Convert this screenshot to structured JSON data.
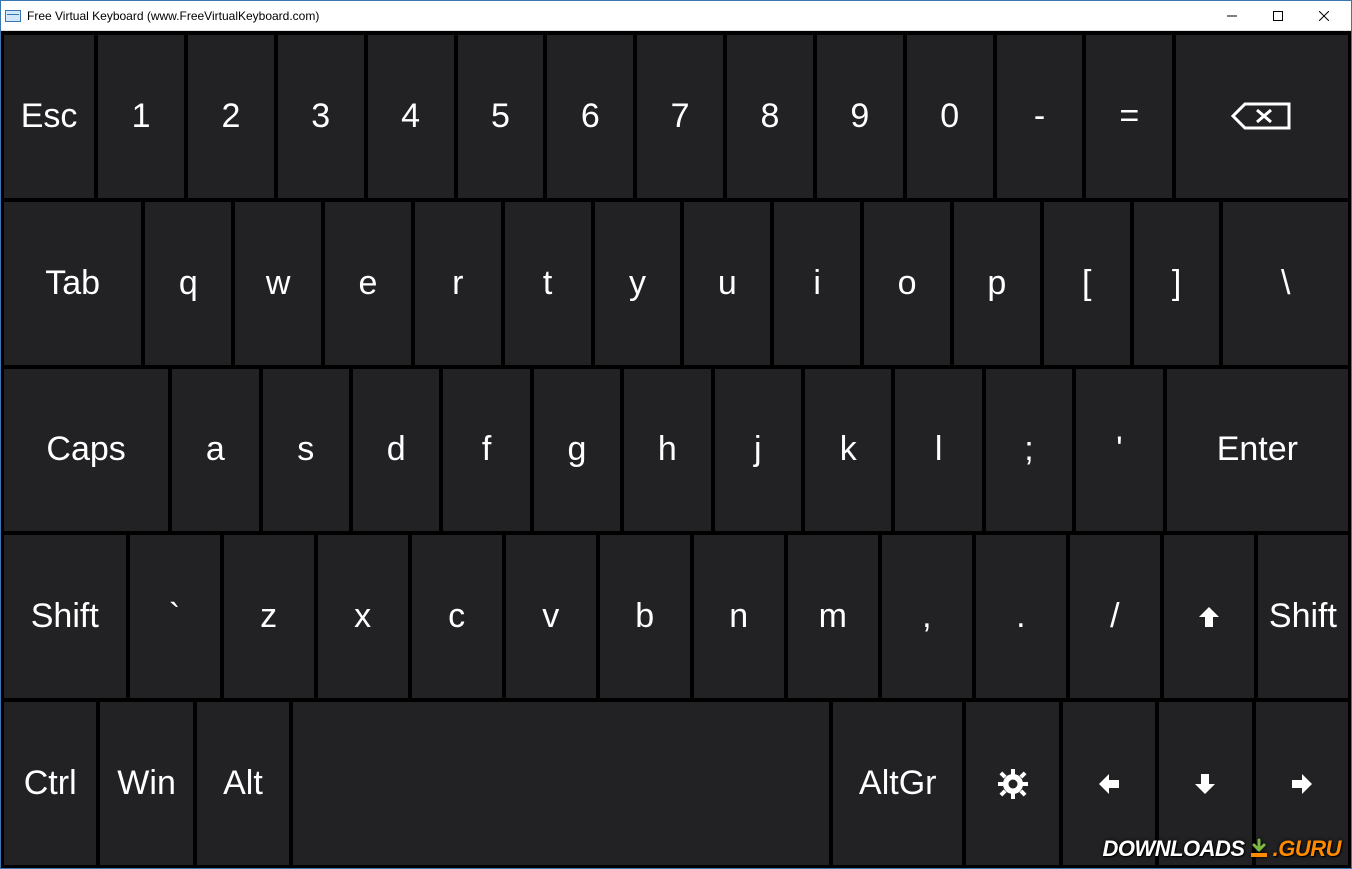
{
  "window": {
    "title": "Free Virtual Keyboard (www.FreeVirtualKeyboard.com)"
  },
  "colors": {
    "key_bg": "#222225",
    "client_bg": "#000000",
    "text": "#ffffff"
  },
  "rows": [
    {
      "keys": [
        {
          "id": "esc",
          "label": "Esc",
          "flex": 1.05
        },
        {
          "id": "1",
          "label": "1",
          "flex": 1
        },
        {
          "id": "2",
          "label": "2",
          "flex": 1
        },
        {
          "id": "3",
          "label": "3",
          "flex": 1
        },
        {
          "id": "4",
          "label": "4",
          "flex": 1
        },
        {
          "id": "5",
          "label": "5",
          "flex": 1
        },
        {
          "id": "6",
          "label": "6",
          "flex": 1
        },
        {
          "id": "7",
          "label": "7",
          "flex": 1
        },
        {
          "id": "8",
          "label": "8",
          "flex": 1
        },
        {
          "id": "9",
          "label": "9",
          "flex": 1
        },
        {
          "id": "0",
          "label": "0",
          "flex": 1
        },
        {
          "id": "minus",
          "label": "-",
          "flex": 1
        },
        {
          "id": "equal",
          "label": "=",
          "flex": 1
        },
        {
          "id": "backspace",
          "icon": "backspace",
          "flex": 2.0
        }
      ]
    },
    {
      "keys": [
        {
          "id": "tab",
          "label": "Tab",
          "flex": 1.6
        },
        {
          "id": "q",
          "label": "q",
          "flex": 1
        },
        {
          "id": "w",
          "label": "w",
          "flex": 1
        },
        {
          "id": "e",
          "label": "e",
          "flex": 1
        },
        {
          "id": "r",
          "label": "r",
          "flex": 1
        },
        {
          "id": "t",
          "label": "t",
          "flex": 1
        },
        {
          "id": "y",
          "label": "y",
          "flex": 1
        },
        {
          "id": "u",
          "label": "u",
          "flex": 1
        },
        {
          "id": "i",
          "label": "i",
          "flex": 1
        },
        {
          "id": "o",
          "label": "o",
          "flex": 1
        },
        {
          "id": "p",
          "label": "p",
          "flex": 1
        },
        {
          "id": "lbracket",
          "label": "[",
          "flex": 1
        },
        {
          "id": "rbracket",
          "label": "]",
          "flex": 1
        },
        {
          "id": "backslash",
          "label": "\\",
          "flex": 1.45
        }
      ]
    },
    {
      "keys": [
        {
          "id": "caps",
          "label": "Caps",
          "flex": 1.9
        },
        {
          "id": "a",
          "label": "a",
          "flex": 1
        },
        {
          "id": "s",
          "label": "s",
          "flex": 1
        },
        {
          "id": "d",
          "label": "d",
          "flex": 1
        },
        {
          "id": "f",
          "label": "f",
          "flex": 1
        },
        {
          "id": "g",
          "label": "g",
          "flex": 1
        },
        {
          "id": "h",
          "label": "h",
          "flex": 1
        },
        {
          "id": "j",
          "label": "j",
          "flex": 1
        },
        {
          "id": "k",
          "label": "k",
          "flex": 1
        },
        {
          "id": "l",
          "label": "l",
          "flex": 1
        },
        {
          "id": "semicolon",
          "label": ";",
          "flex": 1
        },
        {
          "id": "apostrophe",
          "label": "'",
          "flex": 1
        },
        {
          "id": "enter",
          "label": "Enter",
          "flex": 2.1
        }
      ]
    },
    {
      "keys": [
        {
          "id": "shift-left",
          "label": "Shift",
          "flex": 1.35
        },
        {
          "id": "backtick",
          "label": "`",
          "flex": 1
        },
        {
          "id": "z",
          "label": "z",
          "flex": 1
        },
        {
          "id": "x",
          "label": "x",
          "flex": 1
        },
        {
          "id": "c",
          "label": "c",
          "flex": 1
        },
        {
          "id": "v",
          "label": "v",
          "flex": 1
        },
        {
          "id": "b",
          "label": "b",
          "flex": 1
        },
        {
          "id": "n",
          "label": "n",
          "flex": 1
        },
        {
          "id": "m",
          "label": "m",
          "flex": 1
        },
        {
          "id": "comma",
          "label": ",",
          "flex": 1
        },
        {
          "id": "period",
          "label": ".",
          "flex": 1
        },
        {
          "id": "slash",
          "label": "/",
          "flex": 1
        },
        {
          "id": "arrow-up",
          "icon": "arrow-up",
          "flex": 1
        },
        {
          "id": "shift-right",
          "label": "Shift",
          "flex": 1.0
        }
      ]
    },
    {
      "keys": [
        {
          "id": "ctrl",
          "label": "Ctrl",
          "flex": 1
        },
        {
          "id": "win",
          "label": "Win",
          "flex": 1
        },
        {
          "id": "alt",
          "label": "Alt",
          "flex": 1
        },
        {
          "id": "space",
          "label": "",
          "flex": 5.8
        },
        {
          "id": "altgr",
          "label": "AltGr",
          "flex": 1.4
        },
        {
          "id": "settings",
          "icon": "gear",
          "flex": 1
        },
        {
          "id": "arrow-left",
          "icon": "arrow-left",
          "flex": 1
        },
        {
          "id": "arrow-down",
          "icon": "arrow-down",
          "flex": 1
        },
        {
          "id": "arrow-right",
          "icon": "arrow-right",
          "flex": 1
        }
      ]
    }
  ],
  "watermark": {
    "left": "DOWNLOADS",
    "right": ".GURU"
  }
}
